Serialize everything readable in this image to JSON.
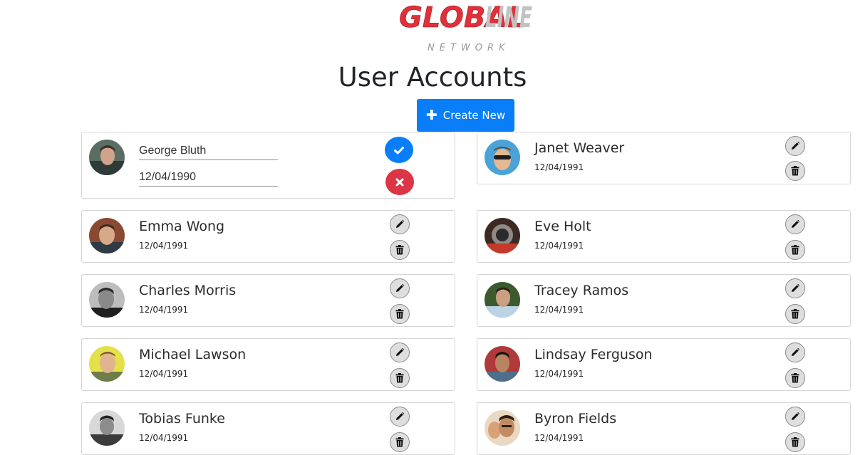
{
  "brand": {
    "logo_text_primary": "GLOBAL",
    "logo_text_secondary": "LINE",
    "logo_subtitle": "NETWORK"
  },
  "page": {
    "title": "User Accounts",
    "create_button_label": "Create New",
    "create_button_icon": "plus-icon"
  },
  "colors": {
    "primary": "#0a7ef8",
    "danger": "#dc3545",
    "logo_red": "#e0303a",
    "logo_gray": "#c2c2c2"
  },
  "editing_user": {
    "name_value": "George Bluth",
    "dob_value": "12/04/1990",
    "confirm_icon": "check-icon",
    "cancel_icon": "close-icon"
  },
  "users": [
    {
      "name": "Janet Weaver",
      "dob": "12/04/1991"
    },
    {
      "name": "Emma Wong",
      "dob": "12/04/1991"
    },
    {
      "name": "Eve Holt",
      "dob": "12/04/1991"
    },
    {
      "name": "Charles Morris",
      "dob": "12/04/1991"
    },
    {
      "name": "Tracey Ramos",
      "dob": "12/04/1991"
    },
    {
      "name": "Michael Lawson",
      "dob": "12/04/1991"
    },
    {
      "name": "Lindsay Ferguson",
      "dob": "12/04/1991"
    },
    {
      "name": "Tobias Funke",
      "dob": "12/04/1991"
    },
    {
      "name": "Byron Fields",
      "dob": "12/04/1991"
    }
  ],
  "row_actions": {
    "edit_icon": "pencil-icon",
    "delete_icon": "trash-icon"
  }
}
